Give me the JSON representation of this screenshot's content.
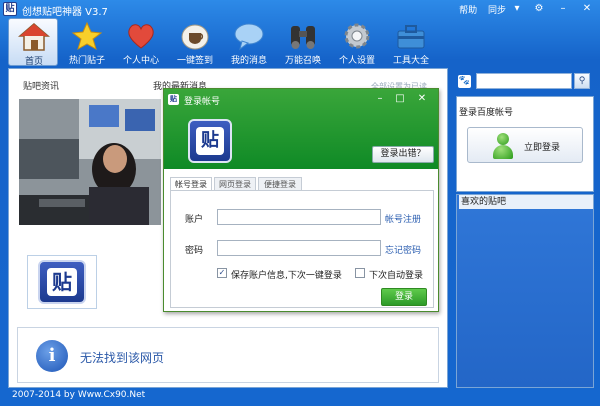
{
  "window": {
    "title": "创想贴吧神器 V3.7",
    "links": [
      "帮助",
      "同步"
    ],
    "controls": [
      "▾",
      "⚙",
      "–",
      "✕"
    ]
  },
  "toolbar": {
    "items": [
      {
        "label": "首页",
        "icon": "home-icon",
        "color": "#e7a23b"
      },
      {
        "label": "热门贴子",
        "icon": "star-icon",
        "color": "#f3c21b"
      },
      {
        "label": "个人中心",
        "icon": "heart-icon",
        "color": "#e24a3b"
      },
      {
        "label": "一键签到",
        "icon": "cup-icon",
        "color": "#c8b98f"
      },
      {
        "label": "我的消息",
        "icon": "chat-bubble-icon",
        "color": "#7fb3e8"
      },
      {
        "label": "万能召唤",
        "icon": "binoculars-icon",
        "color": "#444444"
      },
      {
        "label": "个人设置",
        "icon": "gear-icon",
        "color": "#b8c0c8"
      },
      {
        "label": "工具大全",
        "icon": "toolbox-icon",
        "color": "#3f8fd8"
      }
    ]
  },
  "main": {
    "news_tab": "贴吧资讯",
    "msg_tab": "我的最新消息",
    "sub_right": "全部设置为已读",
    "logo_char": "贴",
    "error": "无法找到该网页"
  },
  "right": {
    "search_value": "",
    "login_head": "登录百度帐号",
    "login_button": "立即登录",
    "fav_head": "喜欢的贴吧"
  },
  "footer": "2007-2014 by Www.Cx90.Net",
  "dialog": {
    "title": "登录帐号",
    "logo_char": "贴",
    "error_button": "登录出错？",
    "tabs": [
      "帐号登录",
      "网页登录",
      "便捷登录"
    ],
    "account_label": "账户",
    "password_label": "密码",
    "account_value": "",
    "password_value": "",
    "register_link": "帐号注册",
    "forgot_link": "忘记密码",
    "save_label": "保存账户信息,下次一键登录",
    "save_checked": "✓",
    "auto_label": "下次自动登录",
    "login_button": "登录"
  }
}
